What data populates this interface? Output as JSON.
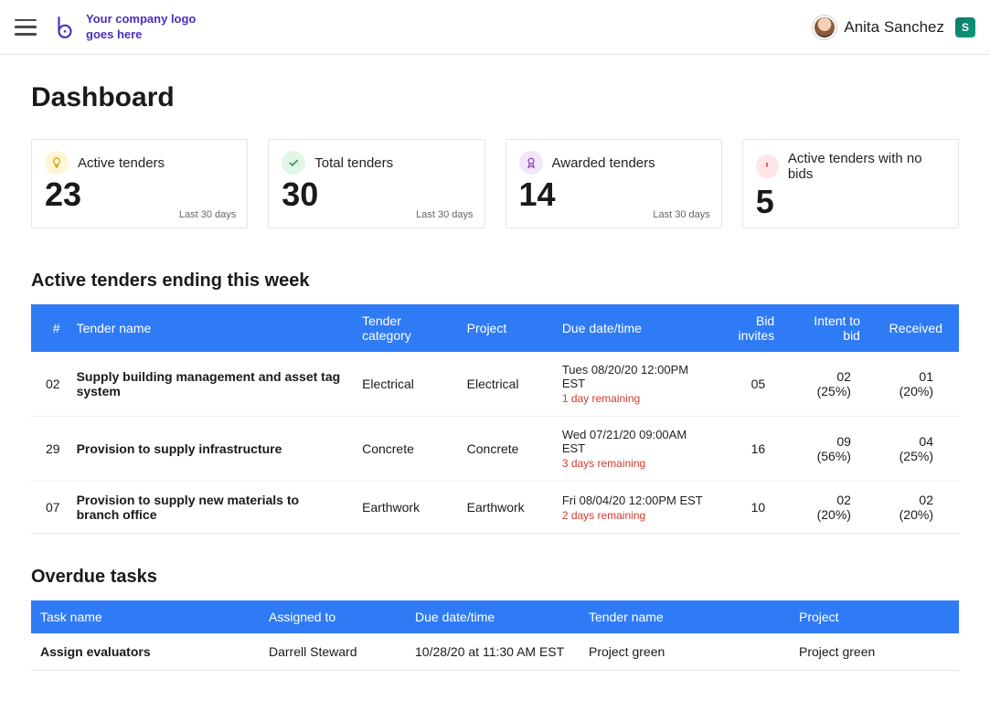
{
  "header": {
    "logo_text": "Your company logo\ngoes here",
    "user_name": "Anita Sanchez",
    "share_label": "S"
  },
  "page_title": "Dashboard",
  "cards": [
    {
      "icon": "lightbulb",
      "label": "Active tenders",
      "value": "23",
      "sub": "Last 30 days"
    },
    {
      "icon": "check",
      "label": "Total tenders",
      "value": "30",
      "sub": "Last 30 days"
    },
    {
      "icon": "award",
      "label": "Awarded tenders",
      "value": "14",
      "sub": "Last 30 days"
    },
    {
      "icon": "alert",
      "label": "Active tenders with no bids",
      "value": "5",
      "sub": ""
    }
  ],
  "active_section_title": "Active tenders ending this week",
  "active_headers": {
    "num": "#",
    "name": "Tender name",
    "cat": "Tender category",
    "project": "Project",
    "due": "Due date/time",
    "invites": "Bid invites",
    "intent": "Intent to bid",
    "received": "Received"
  },
  "active_rows": [
    {
      "num": "02",
      "name": "Supply building management and asset tag system",
      "cat": "Electrical",
      "project": "Electrical",
      "due": "Tues 08/20/20 12:00PM EST",
      "remaining": "1 day remaining",
      "invites": "05",
      "intent": "02 (25%)",
      "received": "01 (20%)"
    },
    {
      "num": "29",
      "name": "Provision to supply infrastructure",
      "cat": "Concrete",
      "project": "Concrete",
      "due": "Wed 07/21/20 09:00AM EST",
      "remaining": "3 days remaining",
      "invites": "16",
      "intent": "09 (56%)",
      "received": "04 (25%)"
    },
    {
      "num": "07",
      "name": "Provision to supply new materials to branch office",
      "cat": "Earthwork",
      "project": "Earthwork",
      "due": "Fri 08/04/20 12:00PM EST",
      "remaining": "2 days remaining",
      "invites": "10",
      "intent": "02 (20%)",
      "received": "02 (20%)"
    }
  ],
  "overdue_section_title": "Overdue tasks",
  "overdue_headers": {
    "task": "Task name",
    "assigned": "Assigned to",
    "due": "Due date/time",
    "tender": "Tender name",
    "project": "Project"
  },
  "overdue_rows": [
    {
      "task": "Assign evaluators",
      "assigned": "Darrell Steward",
      "due": "10/28/20 at 11:30 AM EST",
      "tender": "Project green",
      "project": "Project green"
    }
  ]
}
